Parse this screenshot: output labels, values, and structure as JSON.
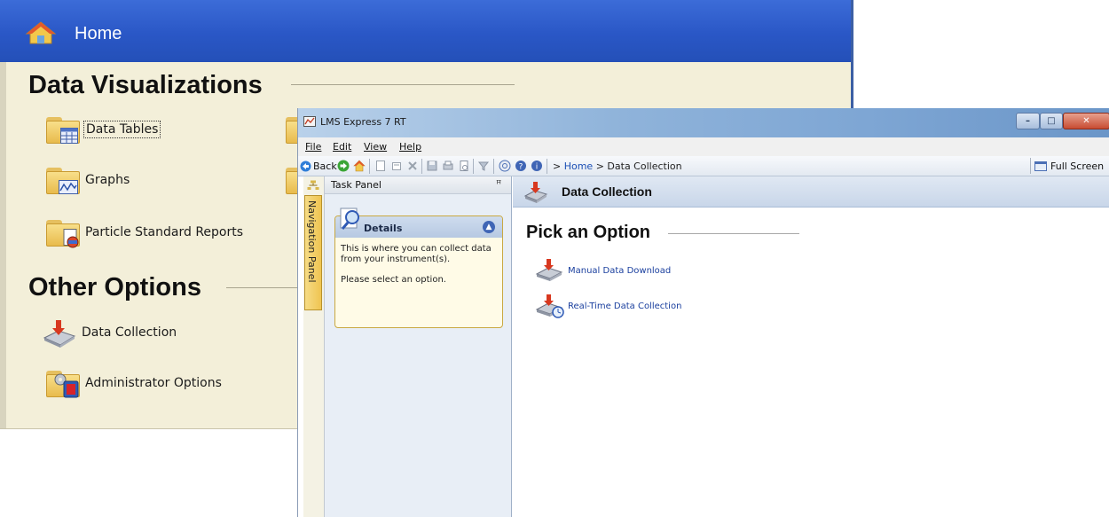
{
  "background_window": {
    "title": "Home",
    "sections": [
      {
        "title": "Data Visualizations"
      },
      {
        "title": "Other Options"
      }
    ],
    "data_visualizations": [
      {
        "label": "Data Tables",
        "icon": "data-tables-folder-icon",
        "focused": true
      },
      {
        "label": "Graphs",
        "icon": "graphs-folder-icon"
      },
      {
        "label": "Particle Standard Reports",
        "icon": "reports-folder-icon"
      }
    ],
    "other_options": [
      {
        "label": "Data Collection",
        "icon": "data-collection-icon"
      },
      {
        "label": "Administrator Options",
        "icon": "administrator-options-icon"
      }
    ]
  },
  "app_window": {
    "title": "LMS Express 7 RT",
    "caption_buttons": {
      "minimize": "–",
      "maximize": "□",
      "close": "✕"
    },
    "menu": [
      "File",
      "Edit",
      "View",
      "Help"
    ],
    "toolbar": {
      "back_label": "Back",
      "breadcrumb_prefix": ">",
      "breadcrumb_link": "Home",
      "breadcrumb_current": "> Data Collection",
      "fullscreen_label": "Full Screen"
    },
    "nav_panel_label": "Navigation Panel",
    "task_panel": {
      "title": "Task Panel",
      "pin_glyph": "ꟸ",
      "details": {
        "title": "Details",
        "text_1": "This is where you can collect data from your instrument(s).",
        "text_2": "Please select an option."
      }
    },
    "content": {
      "header_title": "Data Collection",
      "section_title": "Pick an Option",
      "options": [
        {
          "label": "Manual Data Download",
          "icon": "manual-download-icon"
        },
        {
          "label": "Real-Time Data Collection",
          "icon": "real-time-collection-icon"
        }
      ]
    }
  },
  "colors": {
    "header_blue": "#2a57c6",
    "panel_beige": "#f3efd9",
    "link_blue": "#1a3f9e",
    "nav_tab_gold": "#efc451"
  }
}
